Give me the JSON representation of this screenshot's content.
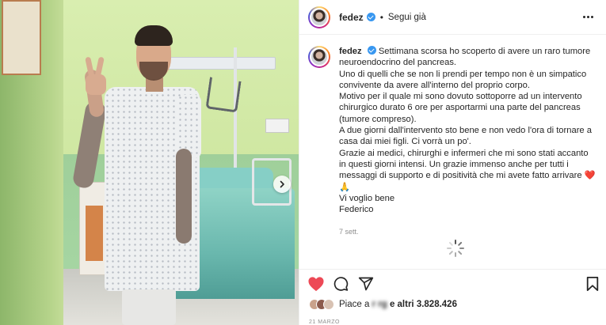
{
  "post": {
    "username": "fedez",
    "follow_state": "Segui già",
    "dot_separator": "•"
  },
  "caption": {
    "username": "fedez",
    "first_line": "Settimana scorsa ho scoperto di avere un raro tumore neuroendocrino del pancreas.",
    "lines": [
      "Uno di quelli che se non li prendi per tempo non è un simpatico convivente da avere all'interno del proprio corpo.",
      "Motivo per il quale mi sono dovuto sottoporre ad un intervento chirurgico durato 6 ore per asportarmi una parte del pancreas (tumore compreso).",
      "A due giorni dall'intervento sto bene e non vedo l'ora di tornare a casa dai miei figli. Ci vorrà un po'.",
      "Grazie ai medici, chirurghi e infermeri che mi sono stati accanto in questi giorni intensi. Un grazie immenso anche per tutti i messaggi di supporto e di positività che mi avete fatto arrivare ❤️🙏",
      "Vi voglio bene",
      "Federico"
    ],
    "timestamp": "7 sett."
  },
  "likes": {
    "prefix": "Piace a",
    "blurred_name": "r   rg",
    "count_text": "e altri 3.828.426"
  },
  "date": "21 MARZO",
  "icons": {
    "like": "heart-icon",
    "comment": "comment-icon",
    "share": "send-icon",
    "save": "bookmark-icon",
    "more": "more-options-icon",
    "carousel": "chevron-right-icon"
  },
  "colors": {
    "like_red": "#ed4956",
    "verified_blue": "#3897f0",
    "secondary_text": "#8e8e8e"
  }
}
